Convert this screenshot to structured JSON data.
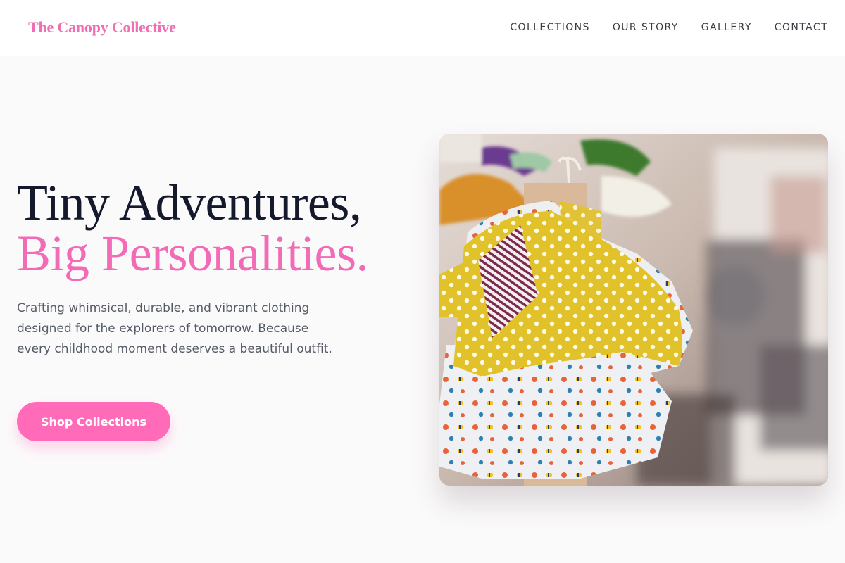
{
  "brand": {
    "name": "The Canopy Collective"
  },
  "nav": [
    {
      "label": "COLLECTIONS"
    },
    {
      "label": "OUR STORY"
    },
    {
      "label": "GALLERY"
    },
    {
      "label": "CONTACT"
    }
  ],
  "hero": {
    "headline_line1": "Tiny Adventures,",
    "headline_line2": "Big Personalities.",
    "description": "Crafting whimsical, durable, and vibrant clothing designed for the explorers of tomorrow. Because every childhood moment deserves a beautiful outfit.",
    "cta_label": "Shop Collections",
    "image": {
      "icon": "children-clothing-rack-photo"
    }
  },
  "colors": {
    "brand_pink": "#f06fb4",
    "accent_pink": "#f26bb6",
    "button_pink": "#ff6bb8",
    "headline_navy": "#14192b",
    "body_gray": "#555b66"
  }
}
